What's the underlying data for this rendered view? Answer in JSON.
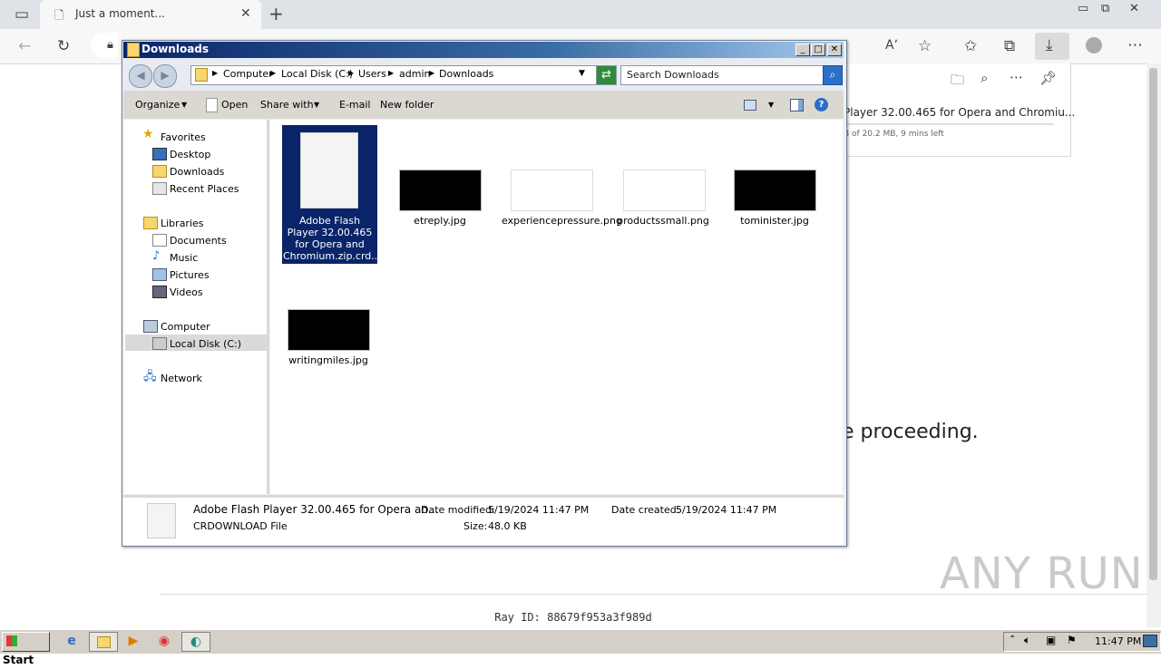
{
  "browser": {
    "tab_title": "Just a moment...",
    "download_item_name": "Player 32.00.465 for Opera and Chromiu...",
    "download_item_progress": "B of 20.2 MB, 9 mins left"
  },
  "page": {
    "proceeding_text": "e proceeding.",
    "ray_id": "Ray ID: 88679f953a3f989d",
    "watermark": "ANY RUN"
  },
  "explorer": {
    "title": "Downloads",
    "breadcrumb": [
      "Computer",
      "Local Disk (C:)",
      "Users",
      "admin",
      "Downloads"
    ],
    "search_placeholder": "Search Downloads",
    "toolbar": {
      "organize": "Organize",
      "open": "Open",
      "share_with": "Share with",
      "email": "E-mail",
      "new_folder": "New folder"
    },
    "nav": {
      "favorites": "Favorites",
      "desktop": "Desktop",
      "downloads": "Downloads",
      "recent_places": "Recent Places",
      "libraries": "Libraries",
      "documents": "Documents",
      "music": "Music",
      "pictures": "Pictures",
      "videos": "Videos",
      "computer": "Computer",
      "local_disk": "Local Disk (C:)",
      "network": "Network"
    },
    "files": [
      {
        "name": "Adobe Flash Player 32.00.465 for Opera and Chromium.zip.crd..."
      },
      {
        "name": "etreply.jpg"
      },
      {
        "name": "experiencepressure.png"
      },
      {
        "name": "productssmall.png"
      },
      {
        "name": "tominister.jpg"
      },
      {
        "name": "writingmiles.jpg"
      }
    ],
    "details": {
      "name": "Adobe Flash Player 32.00.465 for Opera an...",
      "type": "CRDOWNLOAD File",
      "modified_label": "Date modified:",
      "modified": "5/19/2024 11:47 PM",
      "size_label": "Size:",
      "size": "48.0 KB",
      "created_label": "Date created:",
      "created": "5/19/2024 11:47 PM"
    }
  },
  "taskbar": {
    "start": "Start",
    "clock": "11:47 PM"
  }
}
